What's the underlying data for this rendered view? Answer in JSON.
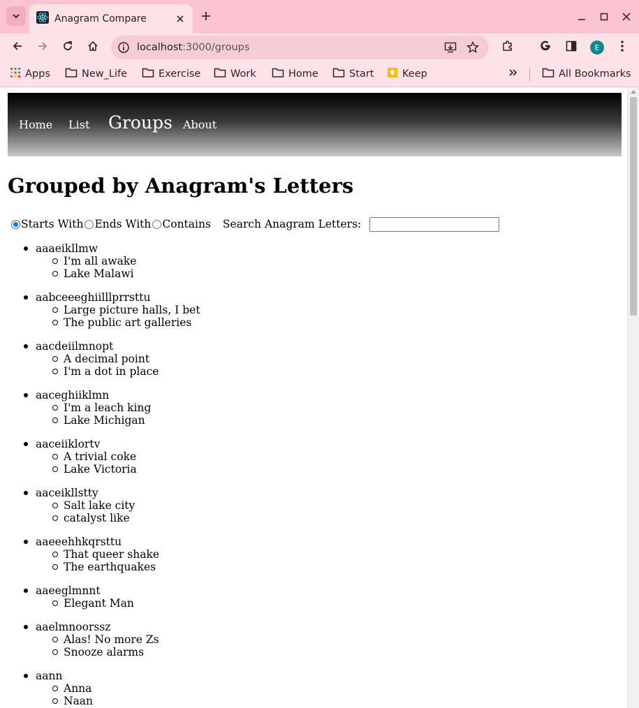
{
  "browser": {
    "tab_title": "Anagram Compare",
    "url_host": "localhost",
    "url_path": ":3000/groups",
    "profile_initial": "E",
    "bookmarks": [
      {
        "label": "Apps",
        "icon": "apps-grid-icon"
      },
      {
        "label": "New_Life",
        "icon": "folder-icon"
      },
      {
        "label": "Exercise",
        "icon": "folder-icon"
      },
      {
        "label": "Work",
        "icon": "folder-icon"
      },
      {
        "label": "Home",
        "icon": "folder-icon"
      },
      {
        "label": "Start",
        "icon": "folder-icon"
      },
      {
        "label": "Keep",
        "icon": "keep-icon"
      }
    ],
    "all_bookmarks": "All Bookmarks"
  },
  "nav": {
    "home": "Home",
    "list": "List",
    "groups": "Groups",
    "about": "About"
  },
  "page": {
    "title": "Grouped by Anagram's Letters",
    "filters": {
      "starts_with": "Starts With",
      "ends_with": "Ends With",
      "contains": "Contains",
      "selected": "Starts With",
      "search_label": "Search Anagram Letters:",
      "search_value": ""
    },
    "groups": [
      {
        "key": "aaaeikllmw",
        "words": [
          "I'm all awake",
          "Lake Malawi"
        ]
      },
      {
        "key": "aabceeeghiilllprrsttu",
        "words": [
          "Large picture halls, I bet",
          "The public art galleries"
        ]
      },
      {
        "key": "aacdeiilmnopt",
        "words": [
          "A decimal point",
          "I'm a dot in place"
        ]
      },
      {
        "key": "aaceghiiklmn",
        "words": [
          "I'm a leach king",
          "Lake Michigan"
        ]
      },
      {
        "key": "aaceiiklortv",
        "words": [
          "A trivial coke",
          "Lake Victoria"
        ]
      },
      {
        "key": "aaceikllstty",
        "words": [
          "Salt lake city",
          "catalyst like"
        ]
      },
      {
        "key": "aaeeehhkqrsttu",
        "words": [
          "That queer shake",
          "The earthquakes"
        ]
      },
      {
        "key": "aaeeglmnnt",
        "words": [
          "Elegant Man"
        ]
      },
      {
        "key": "aaelmnoorssz",
        "words": [
          "Alas! No more Zs",
          "Snooze alarms"
        ]
      },
      {
        "key": "aann",
        "words": [
          "Anna",
          "Naan"
        ]
      }
    ]
  },
  "colors": {
    "chrome_tabstrip": "#fcc4d0",
    "chrome_toolbar": "#fde2e8",
    "nav_gradient_top": "#000000",
    "nav_gradient_bottom": "#c8c8c8",
    "radio_selected": "#1a73e8"
  }
}
